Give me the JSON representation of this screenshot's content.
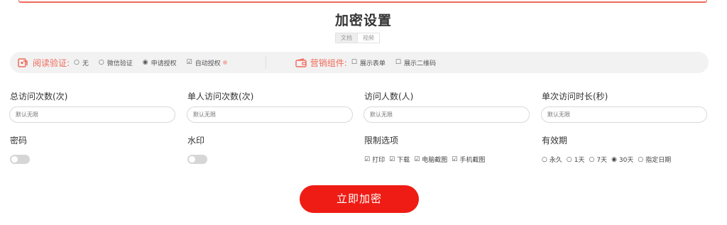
{
  "title": "加密设置",
  "tabs": [
    {
      "label": "文档",
      "active": true
    },
    {
      "label": "视频",
      "active": false
    }
  ],
  "read_verify": {
    "label": "阅读验证:",
    "options": [
      {
        "label": "无",
        "selected": false
      },
      {
        "label": "微信验证",
        "selected": false
      },
      {
        "label": "申请授权",
        "selected": true
      }
    ],
    "auto_auth": {
      "label": "自动授权",
      "checked": true
    }
  },
  "marketing": {
    "label": "营销组件:",
    "options": [
      {
        "label": "展示表单",
        "checked": false
      },
      {
        "label": "展示二维码",
        "checked": false
      }
    ]
  },
  "fields": {
    "total_visits": {
      "label": "总访问次数(次)",
      "placeholder": "默认无限"
    },
    "per_person_visits": {
      "label": "单人访问次数(次)",
      "placeholder": "默认无限"
    },
    "visitors": {
      "label": "访问人数(人)",
      "placeholder": "默认无限"
    },
    "visit_duration": {
      "label": "单次访问时长(秒)",
      "placeholder": "默认无限"
    }
  },
  "password": {
    "label": "密码",
    "enabled": false
  },
  "watermark": {
    "label": "水印",
    "enabled": false
  },
  "restrictions": {
    "label": "限制选项",
    "options": [
      {
        "label": "打印",
        "checked": true
      },
      {
        "label": "下载",
        "checked": true
      },
      {
        "label": "电脑截图",
        "checked": true
      },
      {
        "label": "手机截图",
        "checked": true
      }
    ]
  },
  "validity": {
    "label": "有效期",
    "options": [
      {
        "label": "永久",
        "selected": false
      },
      {
        "label": "1天",
        "selected": false
      },
      {
        "label": "7天",
        "selected": false
      },
      {
        "label": "30天",
        "selected": true
      },
      {
        "label": "指定日期",
        "selected": false
      }
    ]
  },
  "submit_label": "立即加密",
  "colors": {
    "accent": "#ee1c14",
    "label_red": "#f06a5a",
    "bar_bg": "#f2f2f2"
  }
}
